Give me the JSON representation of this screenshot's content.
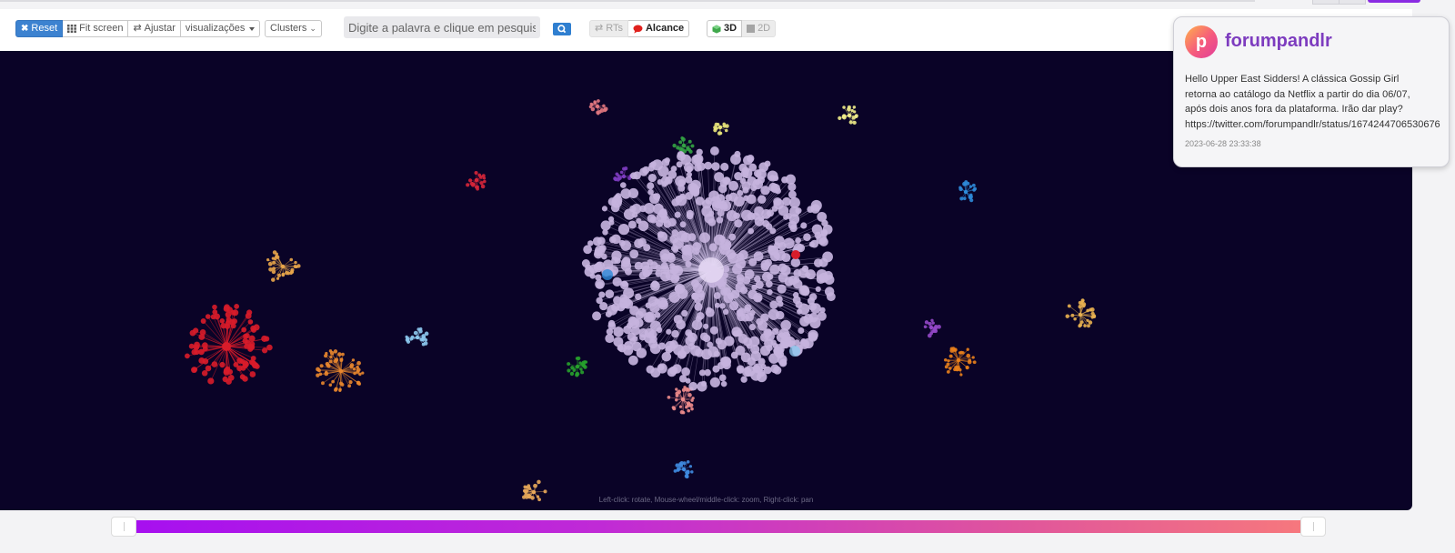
{
  "toolbar": {
    "reset_label": "Reset",
    "fit_label": "Fit screen",
    "ajustar_label": "Ajustar",
    "viz_label": "visualizações",
    "clusters_label": "Clusters",
    "search_placeholder": "Digite a palavra e clique em pesquisar",
    "rts_label": "RTs",
    "alcance_label": "Alcance",
    "mode3d_label": "3D",
    "mode2d_label": "2D"
  },
  "graph": {
    "hint": "Left-click: rotate, Mouse-wheel/middle-click: zoom, Right-click: pan",
    "background": "#0a0327",
    "main_cluster_color": "#c6b3dd",
    "clusters": [
      {
        "color": "#e0777f"
      },
      {
        "color": "#e8e47a"
      },
      {
        "color": "#f0ec8a"
      },
      {
        "color": "#33a344"
      },
      {
        "color": "#7d3cc0"
      },
      {
        "color": "#d6263a"
      },
      {
        "color": "#2d8ad8"
      },
      {
        "color": "#e8a54a"
      },
      {
        "color": "#d81c2a"
      },
      {
        "color": "#e8862e"
      },
      {
        "color": "#8cc8ee"
      },
      {
        "color": "#27a02c"
      },
      {
        "color": "#ee8c8c"
      },
      {
        "color": "#3f8be0"
      },
      {
        "color": "#e8b050"
      },
      {
        "color": "#9448c8"
      },
      {
        "color": "#e8801c"
      },
      {
        "color": "#e8a85a"
      }
    ]
  },
  "tweet_card": {
    "username": "forumpandlr",
    "avatar_letter": "p",
    "text": "Hello Upper East Sidders! A clássica Gossip Girl\nretorna ao catálogo da Netflix a partir do dia 06/07,\napós dois anos fora da plataforma. Irão dar play?\nhttps://twitter.com/forumpandlr/status/1674244706530676",
    "timestamp": "2023-06-28 23:33:38"
  },
  "colors": {
    "accent_blue": "#3c82d0",
    "alcance_icon": "#e0201c",
    "slider_start": "#a60ff0",
    "slider_end": "#f7797c",
    "username": "#7d3cbf"
  }
}
